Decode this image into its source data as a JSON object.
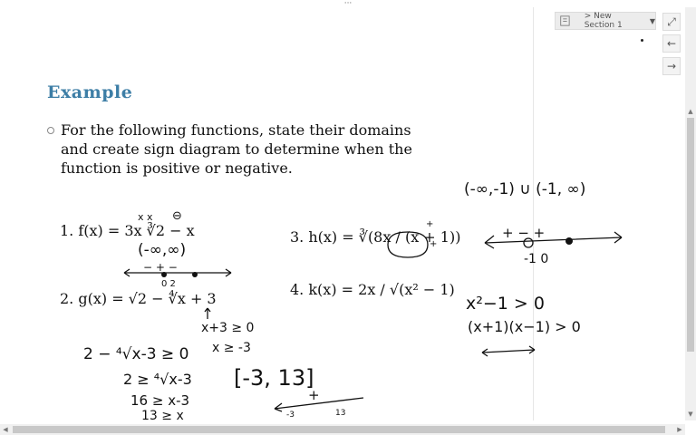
{
  "window": {
    "grip": "···"
  },
  "section": {
    "label": "> New Section 1"
  },
  "controls": {
    "expand": "⤢",
    "back": "←",
    "forward": "→"
  },
  "slide": {
    "heading": "Example",
    "intro": [
      "For the following functions, state their domains",
      "and create sign diagram to determine when the",
      "function is positive or negative."
    ],
    "problems": {
      "p1": "1.  f(x) = 3x ∛2 − x",
      "p2": "2.  g(x) = √2 − ∜x + 3",
      "p3": "3.  h(x) = ∛(8x / (x + 1))",
      "p4": "4.  k(x) = 2x / √(x² − 1)"
    }
  },
  "ink": {
    "xx": "x x",
    "minus_circle": "⊖",
    "domain1": "(-∞,∞)",
    "axis_signs": "− + −",
    "axis_nums": "0   2",
    "x3_ineq": "x+3 ≥ 0",
    "x_ge": "x ≥ -3",
    "step1": "2 − ⁴√x-3 ≥ 0",
    "step2": "2 ≥ ⁴√x-3",
    "step3": "16 ≥ x-3",
    "step4": "13 ≥ x",
    "interval": "[-3, 13]",
    "plus": "+",
    "line_l": "-3",
    "line_r": "13",
    "domain3": "(-∞,-1) ∪ (-1, ∞)",
    "sd3_signs": "+  −  +",
    "sd3_nums": "-1    0",
    "ineq1": "x²−1 > 0",
    "ineq2": "(x+1)(x−1) > 0",
    "h_plus": "+",
    "h_plus2": "+"
  }
}
